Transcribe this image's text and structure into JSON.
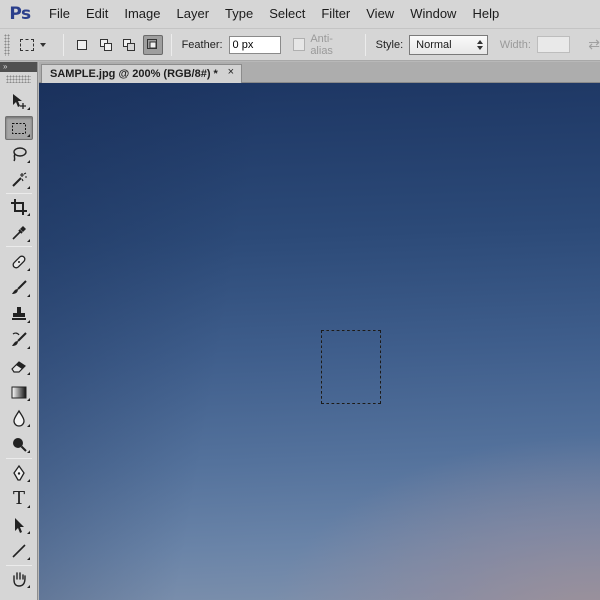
{
  "app": {
    "logo": "Ps"
  },
  "menu": [
    "File",
    "Edit",
    "Image",
    "Layer",
    "Type",
    "Select",
    "Filter",
    "View",
    "Window",
    "Help"
  ],
  "options": {
    "feather_label": "Feather:",
    "feather_value": "0 px",
    "antialias_label": "Anti-alias",
    "style_label": "Style:",
    "style_value": "Normal",
    "width_label": "Width:",
    "active_selection_mode": "new-selection"
  },
  "document": {
    "tab_title": "SAMPLE.jpg @ 200% (RGB/8#) *",
    "close_glyph": "×"
  },
  "toolbar": {
    "collapse_glyph": "»",
    "active_tool": "rectangular-marquee",
    "tools": [
      "move-tool-icon",
      "rectangular-marquee-icon",
      "lasso-icon",
      "quick-selection-icon",
      "crop-icon",
      "eyedropper-icon",
      "spot-healing-icon",
      "brush-icon",
      "clone-stamp-icon",
      "history-brush-icon",
      "eraser-icon",
      "gradient-icon",
      "blur-icon",
      "dodge-icon",
      "pen-icon",
      "type-icon",
      "path-selection-icon",
      "line-icon",
      "hand-icon"
    ],
    "type_tool_glyph": "T"
  },
  "colors": {
    "chrome": "#d6d6d6",
    "logo": "#2b3f8c",
    "canvas_top": "#1d3663",
    "canvas_bottom": "#7d90ac",
    "canvas_warm_corner": "#a49296"
  }
}
